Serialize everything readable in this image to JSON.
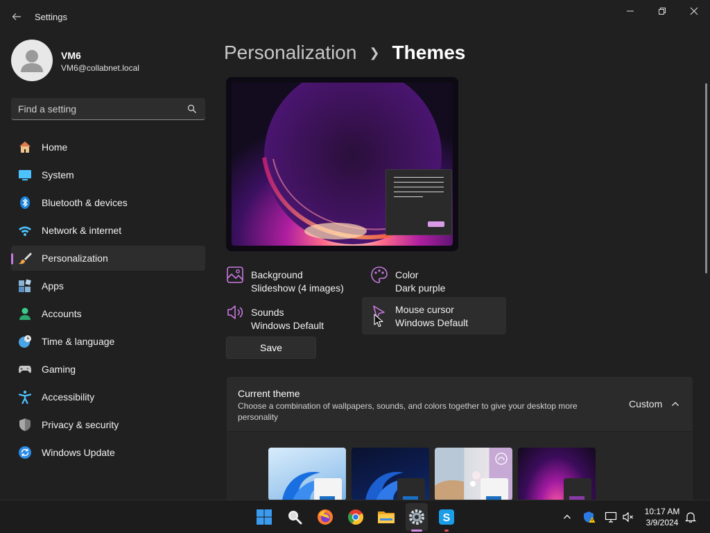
{
  "window": {
    "title": "Settings"
  },
  "profile": {
    "name": "VM6",
    "email": "VM6@collabnet.local"
  },
  "search": {
    "placeholder": "Find a setting"
  },
  "nav": {
    "items": [
      {
        "label": "Home",
        "icon": "home-icon"
      },
      {
        "label": "System",
        "icon": "system-icon"
      },
      {
        "label": "Bluetooth & devices",
        "icon": "bluetooth-icon"
      },
      {
        "label": "Network & internet",
        "icon": "wifi-icon"
      },
      {
        "label": "Personalization",
        "icon": "paintbrush-icon",
        "active": true
      },
      {
        "label": "Apps",
        "icon": "apps-icon"
      },
      {
        "label": "Accounts",
        "icon": "person-icon"
      },
      {
        "label": "Time & language",
        "icon": "clock-globe-icon"
      },
      {
        "label": "Gaming",
        "icon": "gamepad-icon"
      },
      {
        "label": "Accessibility",
        "icon": "accessibility-icon"
      },
      {
        "label": "Privacy & security",
        "icon": "shield-icon"
      },
      {
        "label": "Windows Update",
        "icon": "update-icon"
      }
    ]
  },
  "breadcrumb": {
    "parent": "Personalization",
    "current": "Themes"
  },
  "tiles": {
    "background": {
      "title": "Background",
      "value": "Slideshow (4 images)"
    },
    "color": {
      "title": "Color",
      "value": "Dark purple"
    },
    "sounds": {
      "title": "Sounds",
      "value": "Windows Default"
    },
    "cursor": {
      "title": "Mouse cursor",
      "value": "Windows Default"
    }
  },
  "save_label": "Save",
  "current_theme": {
    "title": "Current theme",
    "description": "Choose a combination of wallpapers, sounds, and colors together to give your desktop more personality",
    "value": "Custom"
  },
  "taskbar": {
    "time": "10:17 AM",
    "date": "3/9/2024",
    "apps": [
      "start-icon",
      "search-icon",
      "firefox-icon",
      "chrome-icon",
      "file-explorer-icon",
      "settings-icon",
      "skype-icon"
    ]
  },
  "colors": {
    "accent": "#c879e0",
    "background": "#202020",
    "card": "#2b2b2b"
  }
}
